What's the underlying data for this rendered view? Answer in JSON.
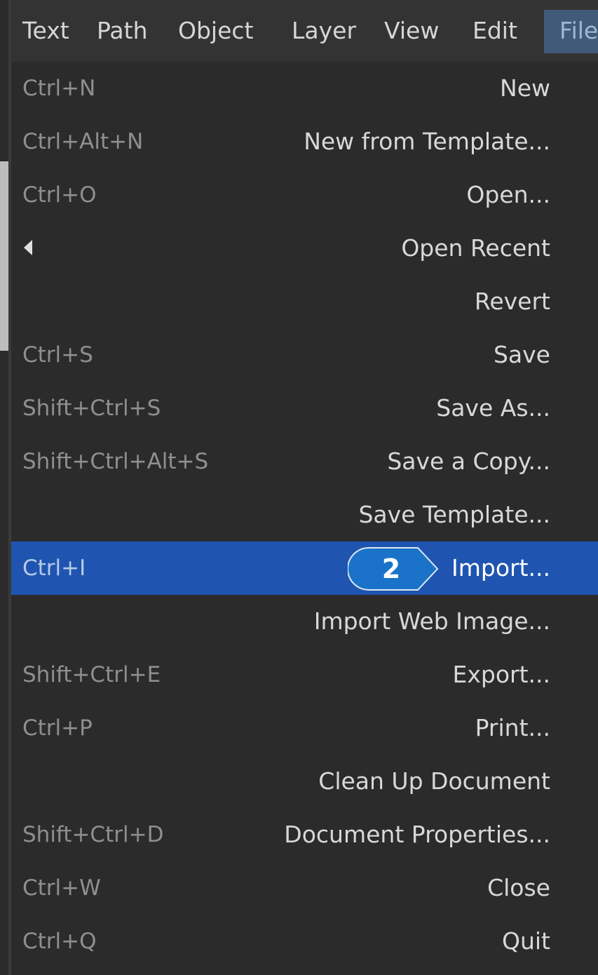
{
  "menubar": {
    "items": [
      "Text",
      "Path",
      "Object",
      "Layer",
      "View",
      "Edit"
    ],
    "active_label": "File"
  },
  "file_menu": {
    "items": [
      {
        "shortcut": "Ctrl+N",
        "label": "New"
      },
      {
        "shortcut": "Ctrl+Alt+N",
        "label": "New from Template..."
      },
      {
        "shortcut": "Ctrl+O",
        "label": "Open..."
      },
      {
        "shortcut": "",
        "label": "Open Recent",
        "submenu_icon": "chevron-left-icon"
      },
      {
        "shortcut": "",
        "label": "Revert"
      },
      {
        "shortcut": "Ctrl+S",
        "label": "Save"
      },
      {
        "shortcut": "Shift+Ctrl+S",
        "label": "Save As..."
      },
      {
        "shortcut": "Shift+Ctrl+Alt+S",
        "label": "Save a Copy..."
      },
      {
        "shortcut": "",
        "label": "Save Template..."
      },
      {
        "shortcut": "Ctrl+I",
        "label": "Import...",
        "highlighted": true
      },
      {
        "shortcut": "",
        "label": "Import Web Image..."
      },
      {
        "shortcut": "Shift+Ctrl+E",
        "label": "Export..."
      },
      {
        "shortcut": "Ctrl+P",
        "label": "Print..."
      },
      {
        "shortcut": "",
        "label": "Clean Up Document"
      },
      {
        "shortcut": "Shift+Ctrl+D",
        "label": "Document Properties..."
      },
      {
        "shortcut": "Ctrl+W",
        "label": "Close"
      },
      {
        "shortcut": "Ctrl+Q",
        "label": "Quit"
      }
    ]
  },
  "callout": {
    "number": "2",
    "color": "#1a73c8"
  },
  "colors": {
    "menu_bg": "#2b2b2b",
    "menubar_bg": "#333333",
    "highlight": "#1f55b0",
    "text": "#d8d8d8",
    "shortcut_text": "#8f8f8f"
  }
}
